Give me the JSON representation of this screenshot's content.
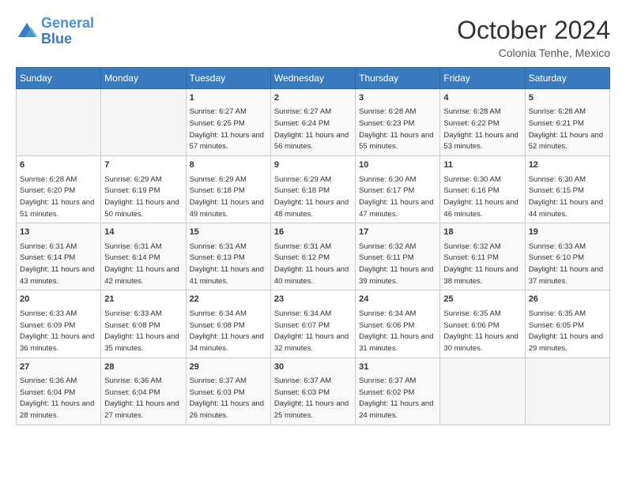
{
  "logo": {
    "line1": "General",
    "line2": "Blue"
  },
  "title": "October 2024",
  "location": "Colonia Tenhe, Mexico",
  "days_of_week": [
    "Sunday",
    "Monday",
    "Tuesday",
    "Wednesday",
    "Thursday",
    "Friday",
    "Saturday"
  ],
  "weeks": [
    [
      {
        "day": "",
        "sunrise": "",
        "sunset": "",
        "daylight": ""
      },
      {
        "day": "",
        "sunrise": "",
        "sunset": "",
        "daylight": ""
      },
      {
        "day": "1",
        "sunrise": "Sunrise: 6:27 AM",
        "sunset": "Sunset: 6:25 PM",
        "daylight": "Daylight: 11 hours and 57 minutes."
      },
      {
        "day": "2",
        "sunrise": "Sunrise: 6:27 AM",
        "sunset": "Sunset: 6:24 PM",
        "daylight": "Daylight: 11 hours and 56 minutes."
      },
      {
        "day": "3",
        "sunrise": "Sunrise: 6:28 AM",
        "sunset": "Sunset: 6:23 PM",
        "daylight": "Daylight: 11 hours and 55 minutes."
      },
      {
        "day": "4",
        "sunrise": "Sunrise: 6:28 AM",
        "sunset": "Sunset: 6:22 PM",
        "daylight": "Daylight: 11 hours and 53 minutes."
      },
      {
        "day": "5",
        "sunrise": "Sunrise: 6:28 AM",
        "sunset": "Sunset: 6:21 PM",
        "daylight": "Daylight: 11 hours and 52 minutes."
      }
    ],
    [
      {
        "day": "6",
        "sunrise": "Sunrise: 6:28 AM",
        "sunset": "Sunset: 6:20 PM",
        "daylight": "Daylight: 11 hours and 51 minutes."
      },
      {
        "day": "7",
        "sunrise": "Sunrise: 6:29 AM",
        "sunset": "Sunset: 6:19 PM",
        "daylight": "Daylight: 11 hours and 50 minutes."
      },
      {
        "day": "8",
        "sunrise": "Sunrise: 6:29 AM",
        "sunset": "Sunset: 6:18 PM",
        "daylight": "Daylight: 11 hours and 49 minutes."
      },
      {
        "day": "9",
        "sunrise": "Sunrise: 6:29 AM",
        "sunset": "Sunset: 6:18 PM",
        "daylight": "Daylight: 11 hours and 48 minutes."
      },
      {
        "day": "10",
        "sunrise": "Sunrise: 6:30 AM",
        "sunset": "Sunset: 6:17 PM",
        "daylight": "Daylight: 11 hours and 47 minutes."
      },
      {
        "day": "11",
        "sunrise": "Sunrise: 6:30 AM",
        "sunset": "Sunset: 6:16 PM",
        "daylight": "Daylight: 11 hours and 46 minutes."
      },
      {
        "day": "12",
        "sunrise": "Sunrise: 6:30 AM",
        "sunset": "Sunset: 6:15 PM",
        "daylight": "Daylight: 11 hours and 44 minutes."
      }
    ],
    [
      {
        "day": "13",
        "sunrise": "Sunrise: 6:31 AM",
        "sunset": "Sunset: 6:14 PM",
        "daylight": "Daylight: 11 hours and 43 minutes."
      },
      {
        "day": "14",
        "sunrise": "Sunrise: 6:31 AM",
        "sunset": "Sunset: 6:14 PM",
        "daylight": "Daylight: 11 hours and 42 minutes."
      },
      {
        "day": "15",
        "sunrise": "Sunrise: 6:31 AM",
        "sunset": "Sunset: 6:13 PM",
        "daylight": "Daylight: 11 hours and 41 minutes."
      },
      {
        "day": "16",
        "sunrise": "Sunrise: 6:31 AM",
        "sunset": "Sunset: 6:12 PM",
        "daylight": "Daylight: 11 hours and 40 minutes."
      },
      {
        "day": "17",
        "sunrise": "Sunrise: 6:32 AM",
        "sunset": "Sunset: 6:11 PM",
        "daylight": "Daylight: 11 hours and 39 minutes."
      },
      {
        "day": "18",
        "sunrise": "Sunrise: 6:32 AM",
        "sunset": "Sunset: 6:11 PM",
        "daylight": "Daylight: 11 hours and 38 minutes."
      },
      {
        "day": "19",
        "sunrise": "Sunrise: 6:33 AM",
        "sunset": "Sunset: 6:10 PM",
        "daylight": "Daylight: 11 hours and 37 minutes."
      }
    ],
    [
      {
        "day": "20",
        "sunrise": "Sunrise: 6:33 AM",
        "sunset": "Sunset: 6:09 PM",
        "daylight": "Daylight: 11 hours and 36 minutes."
      },
      {
        "day": "21",
        "sunrise": "Sunrise: 6:33 AM",
        "sunset": "Sunset: 6:08 PM",
        "daylight": "Daylight: 11 hours and 35 minutes."
      },
      {
        "day": "22",
        "sunrise": "Sunrise: 6:34 AM",
        "sunset": "Sunset: 6:08 PM",
        "daylight": "Daylight: 11 hours and 34 minutes."
      },
      {
        "day": "23",
        "sunrise": "Sunrise: 6:34 AM",
        "sunset": "Sunset: 6:07 PM",
        "daylight": "Daylight: 11 hours and 32 minutes."
      },
      {
        "day": "24",
        "sunrise": "Sunrise: 6:34 AM",
        "sunset": "Sunset: 6:06 PM",
        "daylight": "Daylight: 11 hours and 31 minutes."
      },
      {
        "day": "25",
        "sunrise": "Sunrise: 6:35 AM",
        "sunset": "Sunset: 6:06 PM",
        "daylight": "Daylight: 11 hours and 30 minutes."
      },
      {
        "day": "26",
        "sunrise": "Sunrise: 6:35 AM",
        "sunset": "Sunset: 6:05 PM",
        "daylight": "Daylight: 11 hours and 29 minutes."
      }
    ],
    [
      {
        "day": "27",
        "sunrise": "Sunrise: 6:36 AM",
        "sunset": "Sunset: 6:04 PM",
        "daylight": "Daylight: 11 hours and 28 minutes."
      },
      {
        "day": "28",
        "sunrise": "Sunrise: 6:36 AM",
        "sunset": "Sunset: 6:04 PM",
        "daylight": "Daylight: 11 hours and 27 minutes."
      },
      {
        "day": "29",
        "sunrise": "Sunrise: 6:37 AM",
        "sunset": "Sunset: 6:03 PM",
        "daylight": "Daylight: 11 hours and 26 minutes."
      },
      {
        "day": "30",
        "sunrise": "Sunrise: 6:37 AM",
        "sunset": "Sunset: 6:03 PM",
        "daylight": "Daylight: 11 hours and 25 minutes."
      },
      {
        "day": "31",
        "sunrise": "Sunrise: 6:37 AM",
        "sunset": "Sunset: 6:02 PM",
        "daylight": "Daylight: 11 hours and 24 minutes."
      },
      {
        "day": "",
        "sunrise": "",
        "sunset": "",
        "daylight": ""
      },
      {
        "day": "",
        "sunrise": "",
        "sunset": "",
        "daylight": ""
      }
    ]
  ]
}
